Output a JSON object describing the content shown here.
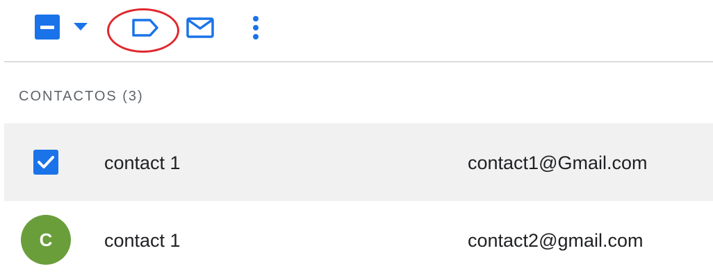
{
  "toolbar": {
    "select_all": {
      "icon": "checkbox-indeterminate-icon",
      "state": "indeterminate"
    },
    "select_menu": {
      "icon": "caret-down-icon"
    },
    "label": {
      "icon": "label-icon"
    },
    "email": {
      "icon": "mail-icon"
    },
    "more": {
      "icon": "more-vert-icon"
    }
  },
  "annotation": {
    "color": "#e0282e",
    "shape": "ellipse",
    "target": "label-icon"
  },
  "section": {
    "header": "CONTACTOS (3)"
  },
  "contacts": [
    {
      "name": "contact 1",
      "email": "contact1@Gmail.com",
      "selected": true
    },
    {
      "name": "contact 1",
      "email": "contact2@gmail.com",
      "selected": false,
      "avatar_letter": "C",
      "avatar_color": "#6a9e3b"
    }
  ],
  "colors": {
    "accent": "#1a73e8",
    "selected_row_bg": "#f1f1f1",
    "text": "#202124",
    "muted": "#5f6368"
  }
}
